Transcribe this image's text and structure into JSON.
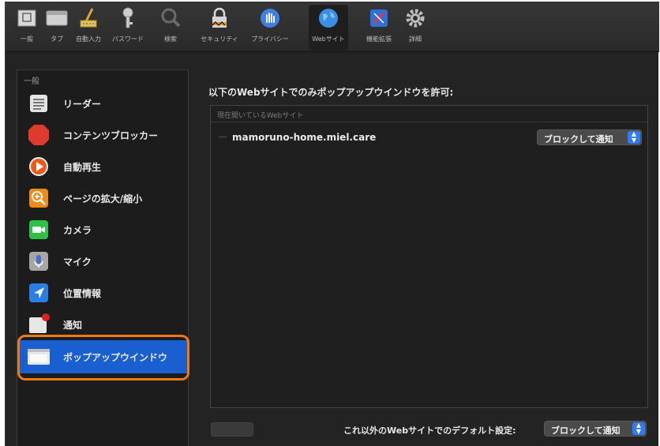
{
  "toolbar": {
    "items": [
      {
        "label": "一般",
        "icon": "general-icon"
      },
      {
        "label": "タブ",
        "icon": "tabs-icon"
      },
      {
        "label": "自動入力",
        "icon": "autofill-pencil-icon"
      },
      {
        "label": "パスワード",
        "icon": "key-icon"
      },
      {
        "label": "検索",
        "icon": "magnifier-icon"
      },
      {
        "label": "セキュリティ",
        "icon": "lock-icon"
      },
      {
        "label": "プライバシー",
        "icon": "hand-icon"
      },
      {
        "label": "Webサイト",
        "icon": "globe-icon"
      },
      {
        "label": "機能拡張",
        "icon": "extensions-icon"
      },
      {
        "label": "詳細",
        "icon": "gear-icon"
      }
    ]
  },
  "sidebar": {
    "header": "一般",
    "items": [
      {
        "label": "リーダー",
        "icon": "reader-icon"
      },
      {
        "label": "コンテンツブロッカー",
        "icon": "stop-sign-icon"
      },
      {
        "label": "自動再生",
        "icon": "play-icon"
      },
      {
        "label": "ページの拡大/縮小",
        "icon": "zoom-icon"
      },
      {
        "label": "カメラ",
        "icon": "camera-icon"
      },
      {
        "label": "マイク",
        "icon": "microphone-icon"
      },
      {
        "label": "位置情報",
        "icon": "location-arrow-icon"
      },
      {
        "label": "通知",
        "icon": "notification-icon"
      },
      {
        "label": "ポップアップウインドウ",
        "icon": "popup-window-icon"
      }
    ]
  },
  "main": {
    "title": "以下のWebサイトでのみポップアップウインドウを許可:",
    "list_header": "現在開いているWebサイト",
    "rows": [
      {
        "site": "mamoruno-home.miel.care",
        "setting": "ブロックして通知"
      }
    ],
    "default_label": "これ以外のWebサイトでのデフォルト設定:",
    "default_value": "ブロックして通知"
  },
  "colors": {
    "selection": "#1a5fd0",
    "highlight_ring": "#f07a12",
    "popup_stepper": "#2f7cf6"
  }
}
